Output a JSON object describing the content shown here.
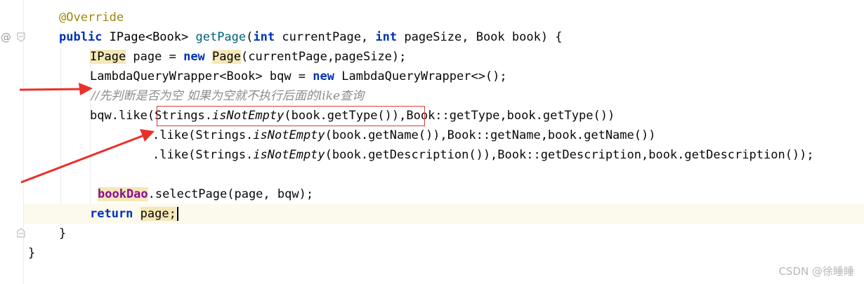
{
  "editor": {
    "lines": [
      {
        "tokens": [
          {
            "t": "@Override",
            "c": "ann"
          }
        ]
      },
      {
        "tokens": [
          {
            "t": "public ",
            "c": "kw"
          },
          {
            "t": "IPage<Book> ",
            "c": "tp"
          },
          {
            "t": "getPage",
            "c": "fn"
          },
          {
            "t": "(",
            "c": "plain"
          },
          {
            "t": "int ",
            "c": "kw"
          },
          {
            "t": "currentPage, ",
            "c": "plain"
          },
          {
            "t": "int ",
            "c": "kw"
          },
          {
            "t": "pageSize, Book book) {",
            "c": "plain"
          }
        ]
      },
      {
        "tokens": [
          {
            "t": "IPage",
            "c": "tp hl"
          },
          {
            "t": " page = ",
            "c": "plain"
          },
          {
            "t": "new ",
            "c": "kw"
          },
          {
            "t": "Page",
            "c": "tp hl"
          },
          {
            "t": "(currentPage,pageSize);",
            "c": "plain"
          }
        ]
      },
      {
        "tokens": [
          {
            "t": "LambdaQueryWrapper<Book> bqw = ",
            "c": "plain"
          },
          {
            "t": "new ",
            "c": "kw"
          },
          {
            "t": "LambdaQueryWrapper<>();",
            "c": "plain"
          }
        ]
      },
      {
        "tokens": [
          {
            "t": "//先判断是否为空 如果为空就不执行后面的like查询",
            "c": "cmt"
          }
        ]
      },
      {
        "tokens": [
          {
            "t": "bqw.like(",
            "c": "plain"
          },
          {
            "t": "Strings.",
            "c": "plain"
          },
          {
            "t": "isNotEmpty",
            "c": "plain ital"
          },
          {
            "t": "(book.getType()),Book::getType,book.getType())",
            "c": "plain"
          }
        ]
      },
      {
        "tokens": [
          {
            "t": ".like(Strings.",
            "c": "plain"
          },
          {
            "t": "isNotEmpty",
            "c": "plain ital"
          },
          {
            "t": "(book.getName()),Book::getName,book.getName())",
            "c": "plain"
          }
        ]
      },
      {
        "tokens": [
          {
            "t": ".like(Strings.",
            "c": "plain"
          },
          {
            "t": "isNotEmpty",
            "c": "plain ital"
          },
          {
            "t": "(book.getDescription()),Book::getDescription,book.getDescription());",
            "c": "plain"
          }
        ]
      },
      {
        "tokens": []
      },
      {
        "tokens": [
          {
            "t": "bookDao",
            "c": "fld hl"
          },
          {
            "t": ".selectPage(page, bqw);",
            "c": "plain"
          }
        ]
      },
      {
        "tokens": [
          {
            "t": "return ",
            "c": "kw"
          },
          {
            "t": "page;",
            "c": "plain hl"
          }
        ]
      },
      {
        "tokens": [
          {
            "t": "}",
            "c": "plain"
          }
        ]
      },
      {
        "tokens": [
          {
            "t": "}",
            "c": "plain"
          }
        ]
      }
    ]
  },
  "gutter": {
    "at_icon": "@",
    "bulb_icon": "lightbulb-icon",
    "fold_icon": "fold-icon"
  },
  "annotations": {
    "arrow_color": "#e8312a",
    "box_color": "#e03a3a"
  },
  "watermark": "CSDN @徐睡睡"
}
